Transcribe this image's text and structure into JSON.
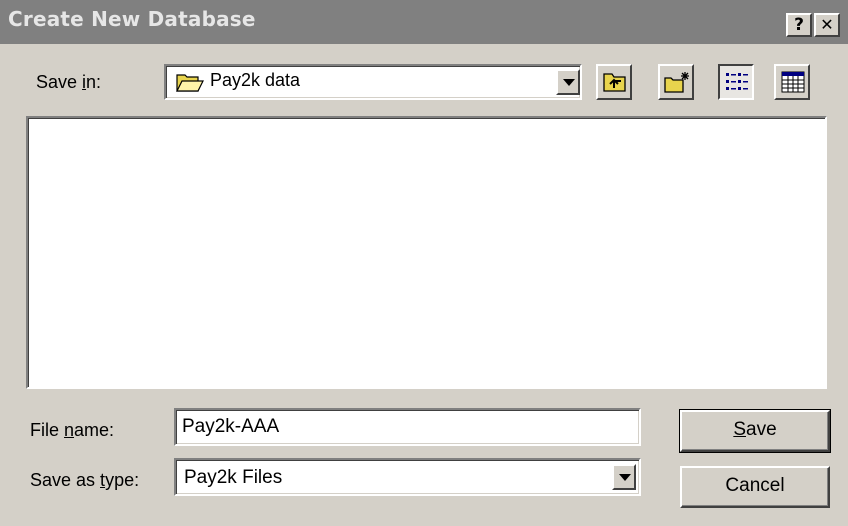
{
  "window": {
    "title": "Create New Database",
    "help_button": "?",
    "close_button": "✕"
  },
  "save_in": {
    "label_before": "Save ",
    "label_accel": "i",
    "label_after": "n:",
    "value": "Pay2k data"
  },
  "toolbar": {
    "up_folder_icon": "up-folder-icon",
    "new_folder_icon": "new-folder-icon",
    "list_view_icon": "list-view-icon",
    "details_view_icon": "details-view-icon"
  },
  "file_list": {
    "items": []
  },
  "file_name": {
    "label_before": "File ",
    "label_accel": "n",
    "label_after": "ame:",
    "value": "Pay2k-AAA"
  },
  "save_as_type": {
    "label_before": "Save as ",
    "label_accel": "t",
    "label_after": "ype:",
    "value": "Pay2k Files"
  },
  "buttons": {
    "save_accel": "S",
    "save_rest": "ave",
    "cancel": "Cancel"
  }
}
